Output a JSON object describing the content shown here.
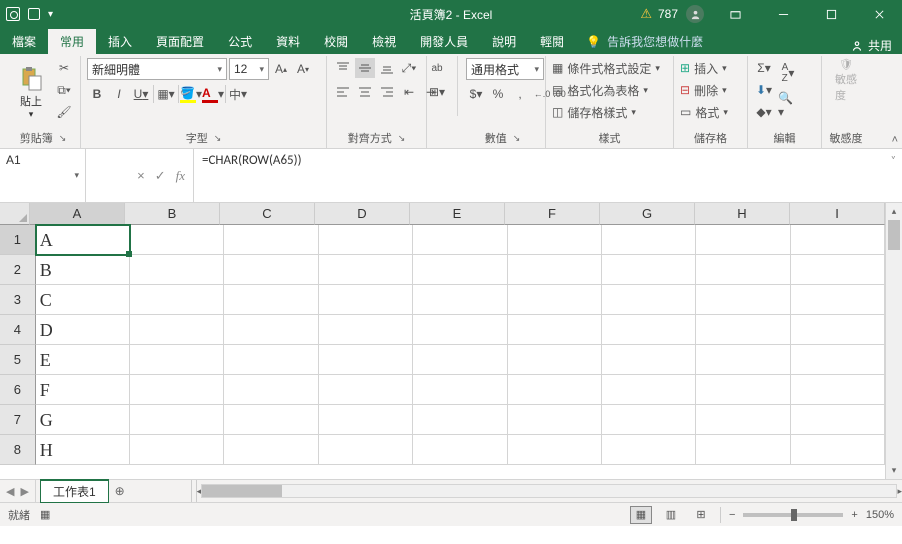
{
  "title": "活頁簿2 - Excel",
  "warn_count": "787",
  "tabs": {
    "file": "檔案",
    "home": "常用",
    "insert": "插入",
    "layout": "頁面配置",
    "formulas": "公式",
    "data": "資料",
    "review": "校閱",
    "view": "檢視",
    "developer": "開發人員",
    "help": "說明",
    "easyread": "輕閱"
  },
  "tell_me": "告訴我您想做什麼",
  "share": "共用",
  "ribbon": {
    "clipboard": {
      "label": "剪貼簿",
      "paste": "貼上"
    },
    "font": {
      "label": "字型",
      "name": "新細明體",
      "size": "12",
      "bold": "B",
      "italic": "I",
      "underline": "U",
      "phonetic": "中"
    },
    "align": {
      "label": "對齊方式",
      "wrap": "ab"
    },
    "number": {
      "label": "數值",
      "format": "通用格式",
      "currency": "$",
      "percent": "%",
      "comma": ",",
      "inc": ".0",
      "dec": ".00"
    },
    "styles": {
      "label": "樣式",
      "cond": "條件式格式設定",
      "table": "格式化為表格",
      "cell": "儲存格樣式"
    },
    "cells": {
      "label": "儲存格",
      "insert": "插入",
      "delete": "刪除",
      "format": "格式"
    },
    "editing": {
      "label": "編輯",
      "sum": "Σ",
      "fill": "↓",
      "clear": "◇",
      "sort": "A↓",
      "find": "⌕"
    },
    "sensit": {
      "label": "敏感度",
      "btn": "敏感\n度"
    }
  },
  "namebox": "A1",
  "formula": "=CHAR(ROW(A65))",
  "fx": {
    "cancel": "×",
    "ok": "✓",
    "fx": "fx"
  },
  "columns": [
    "A",
    "B",
    "C",
    "D",
    "E",
    "F",
    "G",
    "H",
    "I"
  ],
  "rows": [
    {
      "n": "1",
      "cells": [
        "A",
        "",
        "",
        "",
        "",
        "",
        "",
        "",
        ""
      ]
    },
    {
      "n": "2",
      "cells": [
        "B",
        "",
        "",
        "",
        "",
        "",
        "",
        "",
        ""
      ]
    },
    {
      "n": "3",
      "cells": [
        "C",
        "",
        "",
        "",
        "",
        "",
        "",
        "",
        ""
      ]
    },
    {
      "n": "4",
      "cells": [
        "D",
        "",
        "",
        "",
        "",
        "",
        "",
        "",
        ""
      ]
    },
    {
      "n": "5",
      "cells": [
        "E",
        "",
        "",
        "",
        "",
        "",
        "",
        "",
        ""
      ]
    },
    {
      "n": "6",
      "cells": [
        "F",
        "",
        "",
        "",
        "",
        "",
        "",
        "",
        ""
      ]
    },
    {
      "n": "7",
      "cells": [
        "G",
        "",
        "",
        "",
        "",
        "",
        "",
        "",
        ""
      ]
    },
    {
      "n": "8",
      "cells": [
        "H",
        "",
        "",
        "",
        "",
        "",
        "",
        "",
        ""
      ]
    }
  ],
  "sheet_tab": "工作表1",
  "status": {
    "ready": "就緒",
    "zoom": "150%",
    "minus": "−",
    "plus": "+"
  }
}
